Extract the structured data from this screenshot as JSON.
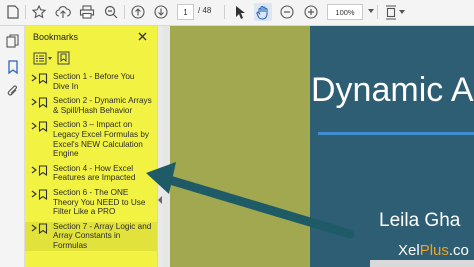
{
  "toolbar": {
    "page_current": "1",
    "page_total": "/ 48",
    "zoom": "100%"
  },
  "bookmarks": {
    "title": "Bookmarks",
    "items": [
      {
        "label": "Section 1 - Before You Dive In"
      },
      {
        "label": "Section 2 - Dynamic Arrays & Spill/Hash Behavior"
      },
      {
        "label": "Section 3 – Impact on Legacy Excel Formulas by Excel's NEW Calculation Engine"
      },
      {
        "label": "Section 4 - How Excel Features are Impacted"
      },
      {
        "label": "Section 6 - The ONE Theory You NEED to Use Filter Like a PRO"
      },
      {
        "label": "Section 7 - Array Logic and Array Constants in Formulas"
      }
    ]
  },
  "slide": {
    "title": "Dynamic A",
    "author": "Leila Gha",
    "brand_main": "Xel",
    "brand_accent": "Plus",
    "brand_suffix": ".co"
  },
  "colors": {
    "panel_highlight": "#f2f243",
    "slide_olive": "#a1a84f",
    "slide_blue": "#2e5e73",
    "arrow": "#1e5b66",
    "brand_accent": "#f4a11a"
  },
  "icons": [
    "star-icon",
    "upload-icon",
    "print-icon",
    "zoom-out-icon",
    "prev-page-icon",
    "next-page-icon",
    "select-cursor-icon",
    "hand-tool-icon",
    "zoom-minus-icon",
    "zoom-plus-icon",
    "fit-page-icon",
    "thumbnails-icon",
    "bookmark-icon",
    "attachment-icon",
    "close-icon",
    "bookmark-options-icon",
    "add-bookmark-icon"
  ]
}
